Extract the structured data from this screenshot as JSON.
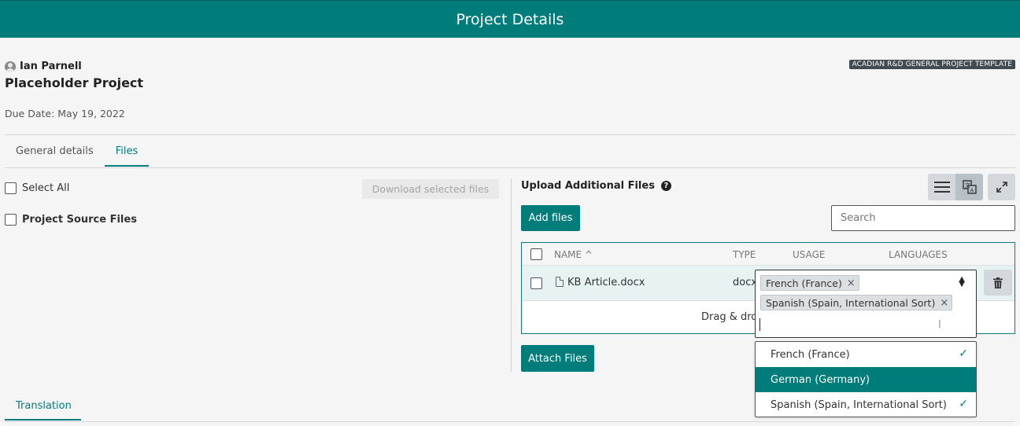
{
  "header": {
    "title": "Project Details"
  },
  "project": {
    "owner": "Ian Parnell",
    "name": "Placeholder Project",
    "template_badge": "ACADIAN R&D GENERAL PROJECT TEMPLATE",
    "due_date": "Due Date: May 19, 2022"
  },
  "tabs": [
    {
      "label": "General details",
      "active": false
    },
    {
      "label": "Files",
      "active": true
    }
  ],
  "left_panel": {
    "select_all_label": "Select All",
    "download_label": "Download selected files",
    "source_files_label": "Project Source Files"
  },
  "upload": {
    "title": "Upload Additional Files",
    "add_files_label": "Add files",
    "search_placeholder": "Search",
    "attach_label": "Attach Files",
    "drop_text": "Drag & dro"
  },
  "table": {
    "columns": [
      "NAME",
      "TYPE",
      "USAGE",
      "LANGUAGES"
    ],
    "rows": [
      {
        "name": "KB Article.docx",
        "type": "docx"
      }
    ]
  },
  "language_select": {
    "selected": [
      "French (France)",
      "Spanish (Spain, International Sort)"
    ],
    "options": [
      {
        "label": "French (France)",
        "checked": true,
        "highlighted": false
      },
      {
        "label": "German (Germany)",
        "checked": false,
        "highlighted": true
      },
      {
        "label": "Spanish (Spain, International Sort)",
        "checked": true,
        "highlighted": false
      }
    ]
  },
  "bottom_tab": {
    "label": "Translation"
  },
  "colors": {
    "accent": "#007d7a",
    "badge": "#424a52"
  },
  "icons": [
    "user-icon",
    "help-icon",
    "list-view-icon",
    "translate-view-icon",
    "expand-icon",
    "file-icon",
    "trash-icon",
    "sort-icon",
    "check-icon",
    "remove-chip-icon"
  ]
}
